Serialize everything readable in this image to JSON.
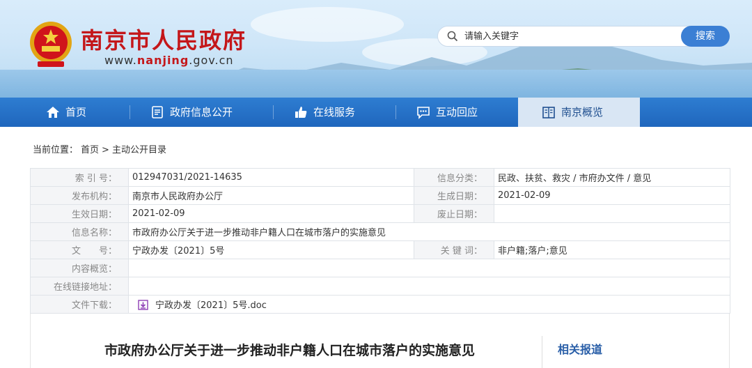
{
  "header": {
    "site_title": "南京市人民政府",
    "site_url_prefix": "www.",
    "site_url_domain": "nanjing",
    "site_url_suffix": ".gov.cn",
    "search_placeholder": "请输入关键字",
    "search_button": "搜索",
    "brand_color": "#c4171a",
    "accent_color": "#3b7fd4"
  },
  "nav": {
    "items": [
      {
        "label": "首页",
        "icon": "home-icon"
      },
      {
        "label": "政府信息公开",
        "icon": "document-icon"
      },
      {
        "label": "在线服务",
        "icon": "thumbs-up-icon"
      },
      {
        "label": "互动回应",
        "icon": "chat-icon"
      },
      {
        "label": "南京概览",
        "icon": "building-icon"
      }
    ],
    "active_index": 4
  },
  "breadcrumb": {
    "prefix": "当前位置：",
    "items": [
      "首页",
      ">",
      "主动公开目录"
    ]
  },
  "info": {
    "index_label": "索 引 号：",
    "index_value": "012947031/2021-14635",
    "category_label": "信息分类：",
    "category_value": "民政、扶贫、救灾 / 市府办文件 / 意见",
    "publisher_label": "发布机构：",
    "publisher_value": "南京市人民政府办公厅",
    "created_label": "生成日期：",
    "created_value": "2021-02-09",
    "effective_label": "生效日期：",
    "effective_value": "2021-02-09",
    "expire_label": "废止日期：",
    "expire_value": "",
    "name_label": "信息名称：",
    "name_value": "市政府办公厅关于进一步推动非户籍人口在城市落户的实施意见",
    "docno_label": "文　　号：",
    "docno_value": "宁政办发〔2021〕5号",
    "keywords_label": "关 键 词：",
    "keywords_value": "非户籍;落户;意见",
    "summary_label": "内容概览：",
    "summary_value": "",
    "link_label": "在线链接地址：",
    "link_value": "",
    "download_label": "文件下载：",
    "download_value": "宁政办发〔2021〕5号.doc"
  },
  "article": {
    "title": "市政府办公厅关于进一步推动非户籍人口在城市落户的实施意见",
    "related_title": "相关报道"
  }
}
